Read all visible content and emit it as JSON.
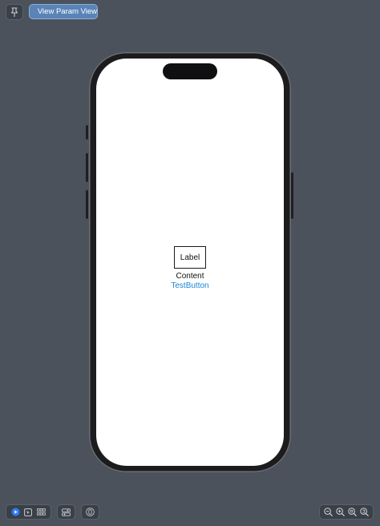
{
  "toolbar": {
    "param_view_label": "View Param View"
  },
  "preview": {
    "label_text": "Label",
    "content_text": "Content",
    "button_text": "TestButton"
  },
  "colors": {
    "background": "#4b525b",
    "accent_button": "#5a84b7",
    "link_blue": "#1a87d8",
    "live_mode": "#2f7cf6"
  },
  "icons": {
    "pin": "pin-icon",
    "param_view": "bag-icon",
    "live": "live-preview-icon",
    "selectable": "selectable-mode-icon",
    "variants": "variants-grid-icon",
    "device_settings": "device-settings-icon",
    "orientation": "orientation-icon",
    "zoom_out": "zoom-out-icon",
    "zoom_in": "zoom-in-icon",
    "zoom_fit": "zoom-fit-icon",
    "zoom_actual": "zoom-actual-icon"
  }
}
